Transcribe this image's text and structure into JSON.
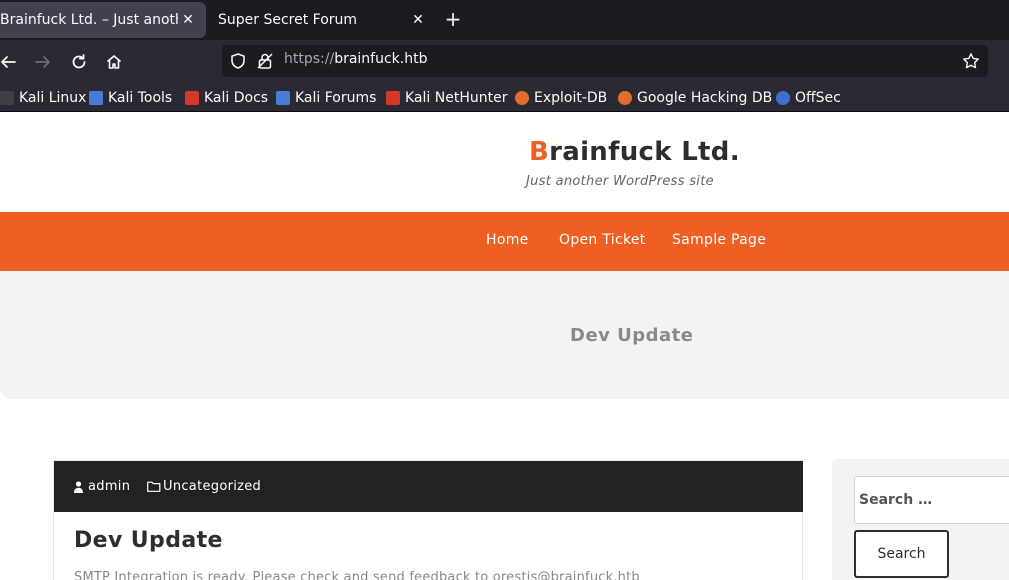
{
  "browser": {
    "tabs": [
      {
        "title": "Brainfuck Ltd. – Just another",
        "active": true
      },
      {
        "title": "Super Secret Forum",
        "active": false
      }
    ],
    "url_scheme": "https://",
    "url_host": "brainfuck.htb",
    "bookmarks": [
      {
        "label": "Kali Linux",
        "icon": "kali-dragon-icon",
        "color": "#3f3f46"
      },
      {
        "label": "Kali Tools",
        "icon": "kali-tools-icon",
        "color": "#4a7bd6"
      },
      {
        "label": "Kali Docs",
        "icon": "kali-docs-icon",
        "color": "#d6372b"
      },
      {
        "label": "Kali Forums",
        "icon": "kali-forums-icon",
        "color": "#4a7bd6"
      },
      {
        "label": "Kali NetHunter",
        "icon": "kali-nethunter-icon",
        "color": "#d6372b"
      },
      {
        "label": "Exploit-DB",
        "icon": "exploit-db-icon",
        "color": "#e36b2b"
      },
      {
        "label": "Google Hacking DB",
        "icon": "ghdb-icon",
        "color": "#e36b2b"
      },
      {
        "label": "OffSec",
        "icon": "offsec-icon",
        "color": "#3d6fd1"
      }
    ]
  },
  "site": {
    "title_first": "B",
    "title_rest": "rainfuck Ltd.",
    "description": "Just another WordPress site",
    "accent_color": "#ef5f22",
    "menu": [
      "Home",
      "Open Ticket",
      "Sample Page"
    ],
    "page_heading": "Dev Update"
  },
  "post": {
    "author": "admin",
    "category": "Uncategorized",
    "title": "Dev Update",
    "excerpt": "SMTP Integration is ready. Please check and send feedback to orestis@brainfuck.htb"
  },
  "sidebar": {
    "search_placeholder": "Search …",
    "search_button": "Search"
  }
}
